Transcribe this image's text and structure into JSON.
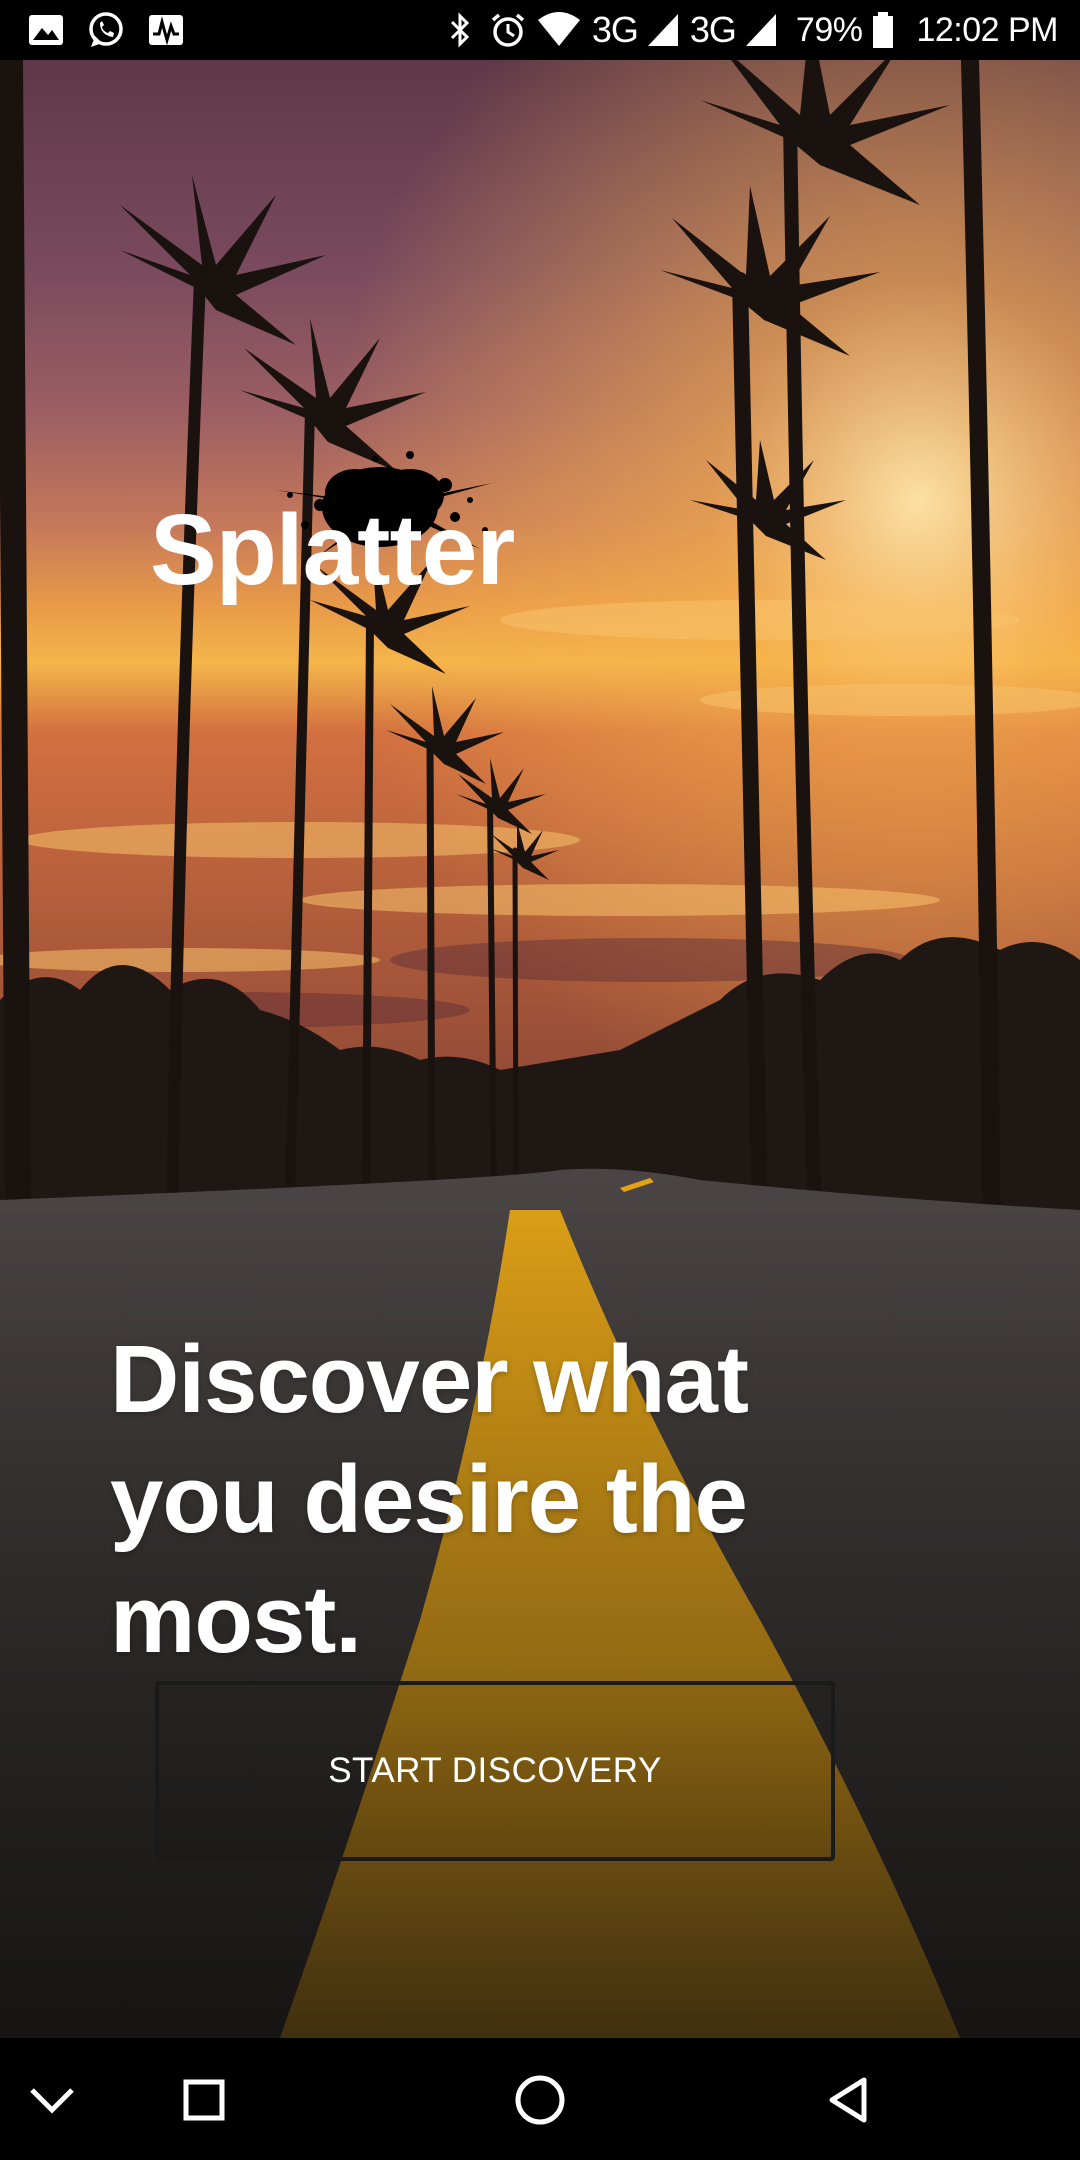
{
  "status_bar": {
    "left_icons": [
      "image-icon",
      "whatsapp-icon",
      "activity-icon"
    ],
    "right_icons": [
      "bluetooth-icon",
      "alarm-icon",
      "wifi-icon",
      "signal-icon",
      "signal-icon-2",
      "battery-icon"
    ],
    "network_1": "3G",
    "network_2": "3G",
    "battery": "79%",
    "time": "12:02 PM"
  },
  "app": {
    "logo_text": "Splatter",
    "headline": "Discover what you desire the most.",
    "start_button_label": "START DISCOVERY"
  },
  "nav_bar": {
    "icons": [
      "chevron-down-icon",
      "recents-square-icon",
      "home-circle-icon",
      "back-triangle-icon"
    ]
  },
  "colors": {
    "sky_top": "#6a3c52",
    "sunset_glow": "#f5a33a",
    "road_line": "#e0a10f",
    "asphalt": "#3d3a37",
    "bar_background": "#000000",
    "text": "#ffffff"
  }
}
